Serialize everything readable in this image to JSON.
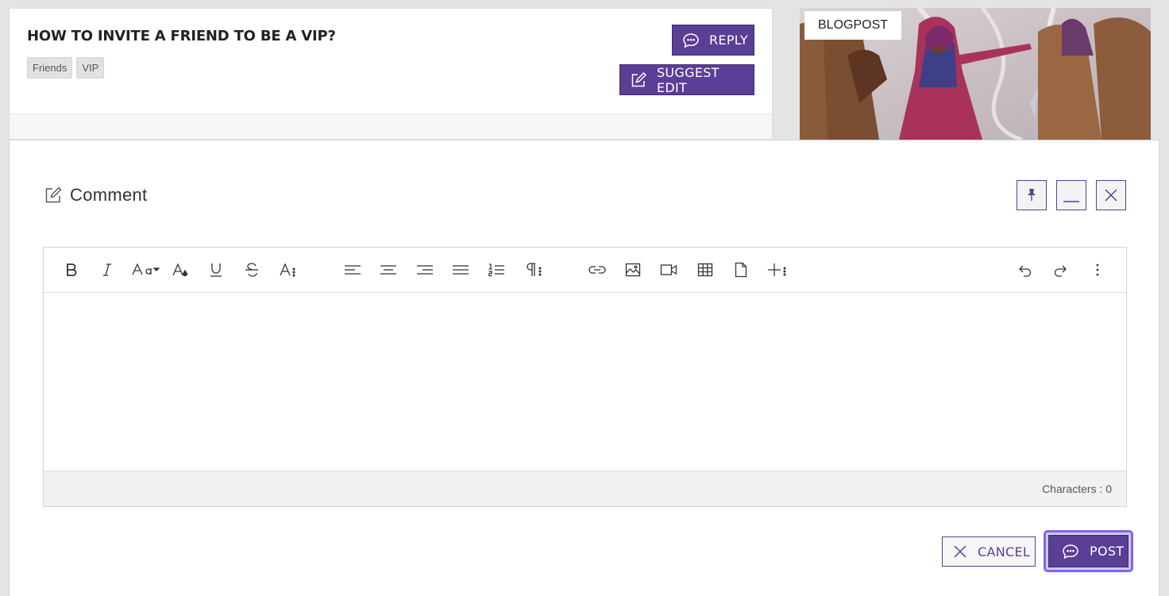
{
  "question": {
    "title": "HOW TO INVITE A FRIEND TO BE A VIP?",
    "tags": [
      "Friends",
      "VIP"
    ],
    "reply_label": "REPLY",
    "suggest_edit_label": "SUGGEST EDIT"
  },
  "blog": {
    "label": "BLOGPOST"
  },
  "comment_modal": {
    "title": "Comment",
    "window_controls": [
      "pin-icon",
      "minimize-icon",
      "close-icon"
    ],
    "toolbar": {
      "left_group": [
        "bold-icon",
        "italic-icon",
        "font-size-icon",
        "text-color-icon",
        "underline-icon",
        "strikethrough-icon",
        "more-text-icon"
      ],
      "paragraph_group": [
        "align-left-icon",
        "align-center-icon",
        "align-right-icon",
        "align-justify-icon",
        "ordered-list-icon",
        "more-paragraph-icon"
      ],
      "insert_group": [
        "link-icon",
        "image-icon",
        "video-icon",
        "table-icon",
        "file-icon",
        "more-insert-icon"
      ],
      "right_group": [
        "undo-icon",
        "redo-icon",
        "more-options-icon"
      ]
    },
    "editor_content": "",
    "character_count_label": "Characters : 0",
    "cancel_label": "CANCEL",
    "post_label": "POST"
  },
  "colors": {
    "brand_purple": "#5b3e96",
    "focus_ring": "#7b68ee",
    "background": "#e4e4e4"
  }
}
